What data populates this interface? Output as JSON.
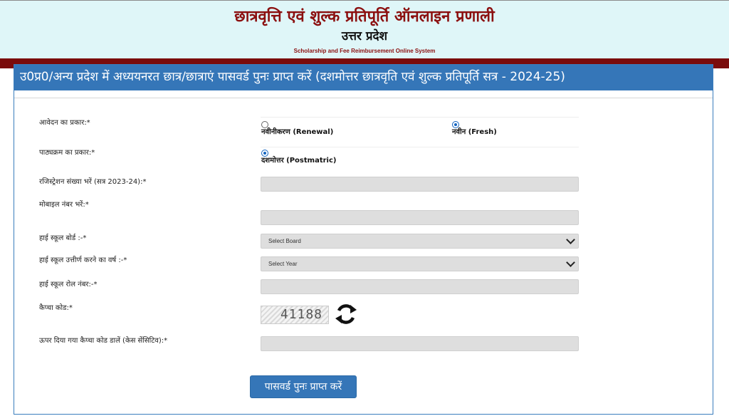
{
  "header": {
    "title_hindi": "छात्रवृत्ति एवं शुल्क प्रतिपूर्ति ऑनलाइन प्रणाली",
    "state": "उत्तर प्रदेश",
    "title_english": "Scholarship and Fee Reimbursement Online System"
  },
  "panel": {
    "heading": "उ0प्र0/अन्य प्रदेश में अध्ययनरत छात्र/छात्राएं पासवर्ड पुनः प्राप्त करें (दशमोत्तर छात्रवृति एवं शुल्क प्रतिपूर्ति सत्र - 2024-25)"
  },
  "form": {
    "application_type": {
      "label": "आवेदन का प्रकार:*",
      "options": [
        "नवीनीकरण (Renewal)",
        "नवीन (Fresh)"
      ],
      "selected": "नवीन (Fresh)"
    },
    "course_type": {
      "label": "पाठ्यक्रम का प्रकार:*",
      "options": [
        "दशमोत्तर (Postmatric)"
      ],
      "selected": "दशमोत्तर (Postmatric)"
    },
    "registration_no": {
      "label": "रजिस्ट्रेशन संख्या भरें (सत्र 2023-24):*",
      "value": ""
    },
    "mobile_no": {
      "label": "मोबाइल नंबर भरें:*",
      "value": ""
    },
    "hs_board": {
      "label": "हाई स्कूल बोर्ड :-*",
      "selected": "Select Board"
    },
    "hs_year": {
      "label": "हाई स्कूल उत्तीर्ण करने का वर्ष :-*",
      "selected": "Select Year"
    },
    "hs_roll": {
      "label": "हाई स्कूल रोल नंबर:-*",
      "value": ""
    },
    "captcha": {
      "label": "कैप्चा कोड:*",
      "code": "41188"
    },
    "captcha_input": {
      "label": "ऊपर दिया गया कैप्चा कोड डालें (केस सेंसिटिव):*",
      "value": ""
    },
    "submit_label": "पासवर्ड पुनः प्राप्त करें"
  },
  "colors": {
    "header_bg": "#dff6f8",
    "title_red": "#8b0f0f",
    "band_red": "#7a0b0b",
    "panel_blue": "#3576b8",
    "field_gray": "#dedede"
  },
  "icons": {
    "refresh": "refresh-icon",
    "dropdown": "chevron-down-icon"
  }
}
